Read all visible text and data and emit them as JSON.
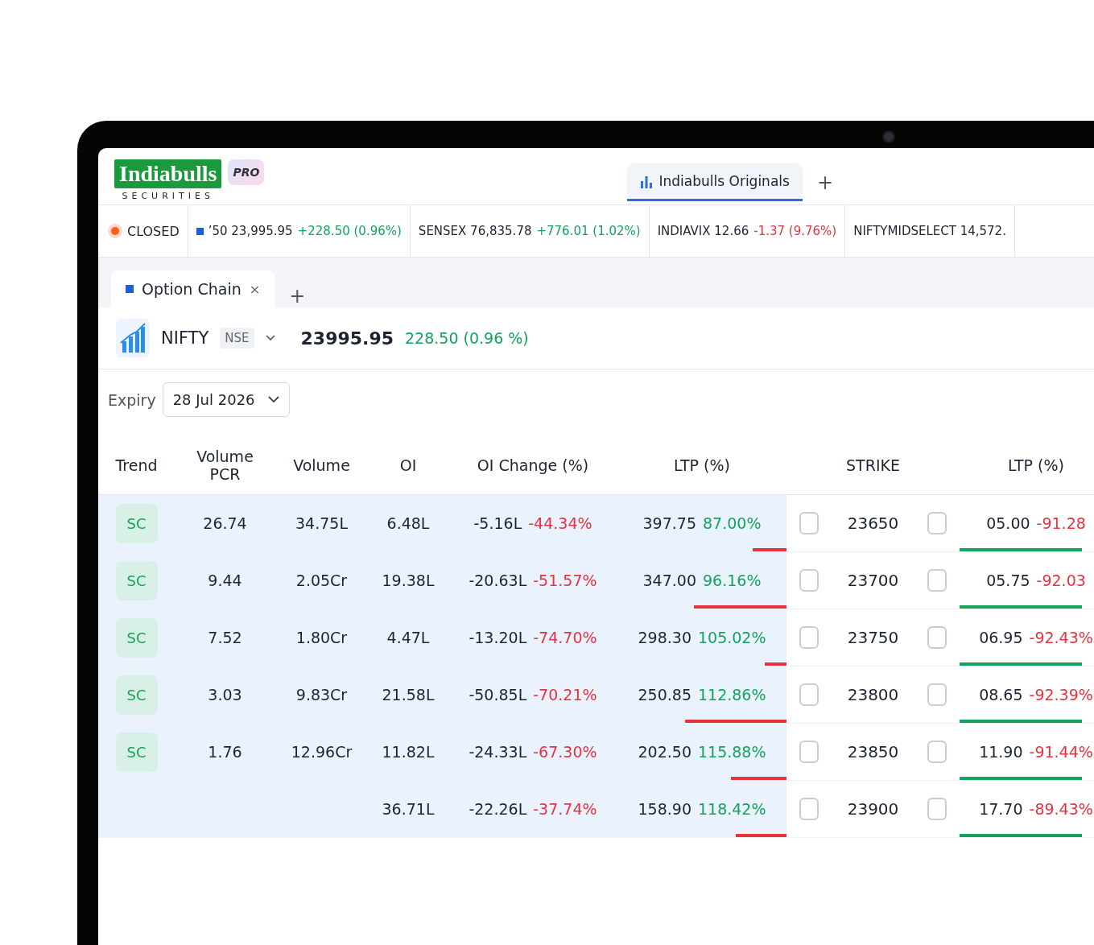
{
  "header": {
    "logo": {
      "name": "Indiabulls",
      "subtitle": "SECURITIES",
      "badge": "PRO"
    },
    "tabs": [
      {
        "label": "Indiabulls Originals",
        "selected": true
      }
    ],
    "add_tab": "+"
  },
  "ticker": {
    "market_status": "CLOSED",
    "items": [
      {
        "name": "’50",
        "value": "23,995.95",
        "change": "+228.50",
        "percent": "(0.96%)",
        "kind": "gain",
        "marker": true
      },
      {
        "name": "SENSEX",
        "value": "76,835.78",
        "change": "+776.01",
        "percent": "(1.02%)",
        "kind": "gain",
        "marker": false
      },
      {
        "name": "INDIAVIX",
        "value": "12.66",
        "change": "-1.37",
        "percent": "(9.76%)",
        "kind": "loss",
        "marker": false
      },
      {
        "name": "NIFTYMIDSELECT",
        "value": "14,572.",
        "kind": "plain",
        "marker": false
      }
    ]
  },
  "workspace_tabs": {
    "tabs": [
      {
        "label": "Option Chain",
        "selected": true,
        "close": "×"
      }
    ],
    "add_tab": "+"
  },
  "instrument": {
    "symbol": "NIFTY",
    "exchange": "NSE",
    "price": "23995.95",
    "change": "228.50 (0.96 %)"
  },
  "expiry": {
    "label": "Expiry",
    "value": "28 Jul 2026"
  },
  "table": {
    "columns": [
      "Trend",
      "Volume PCR",
      "Volume",
      "OI",
      "OI Change (%)",
      "LTP (%)",
      "STRIKE",
      "LTP (%)"
    ],
    "rows": [
      {
        "trend": "SC",
        "volume_pcr": "26.74",
        "volume": "34.75L",
        "oi": "6.48L",
        "oi_change": "-5.16L",
        "oi_change_pct": "-44.34%",
        "ltp": "397.75",
        "ltp_pct": "87.00%",
        "call_bar": {
          "level": 0.2
        },
        "call_checked": false,
        "strike": "23650",
        "put_checked": false,
        "put_ltp": "05.00",
        "put_ltp_pct": "-91.28",
        "put_bar": {
          "level": 0.8
        }
      },
      {
        "trend": "SC",
        "volume_pcr": "9.44",
        "volume": "2.05Cr",
        "oi": "19.38L",
        "oi_change": "-20.63L",
        "oi_change_pct": "-51.57%",
        "ltp": "347.00",
        "ltp_pct": "96.16%",
        "call_bar": {
          "level": 0.55
        },
        "call_checked": false,
        "strike": "23700",
        "put_checked": false,
        "put_ltp": "05.75",
        "put_ltp_pct": "-92.03",
        "put_bar": {
          "level": 0.8
        }
      },
      {
        "trend": "SC",
        "volume_pcr": "7.52",
        "volume": "1.80Cr",
        "oi": "4.47L",
        "oi_change": "-13.20L",
        "oi_change_pct": "-74.70%",
        "ltp": "298.30",
        "ltp_pct": "105.02%",
        "call_bar": {
          "level": 0.13
        },
        "call_checked": false,
        "strike": "23750",
        "put_checked": false,
        "put_ltp": "06.95",
        "put_ltp_pct": "-92.43%",
        "put_bar": {
          "level": 0.8
        }
      },
      {
        "trend": "SC",
        "volume_pcr": "3.03",
        "volume": "9.83Cr",
        "oi": "21.58L",
        "oi_change": "-50.85L",
        "oi_change_pct": "-70.21%",
        "ltp": "250.85",
        "ltp_pct": "112.86%",
        "call_bar": {
          "level": 0.6
        },
        "call_checked": false,
        "strike": "23800",
        "put_checked": false,
        "put_ltp": "08.65",
        "put_ltp_pct": "-92.39%",
        "put_bar": {
          "level": 0.8
        }
      },
      {
        "trend": "SC",
        "volume_pcr": "1.76",
        "volume": "12.96Cr",
        "oi": "11.82L",
        "oi_change": "-24.33L",
        "oi_change_pct": "-67.30%",
        "ltp": "202.50",
        "ltp_pct": "115.88%",
        "call_bar": {
          "level": 0.33
        },
        "call_checked": false,
        "strike": "23850",
        "put_checked": false,
        "put_ltp": "11.90",
        "put_ltp_pct": "-91.44%",
        "put_bar": {
          "level": 0.8
        }
      },
      {
        "oi": "36.71L",
        "oi_change": "-22.26L",
        "oi_change_pct": "-37.74%",
        "ltp": "158.90",
        "ltp_pct": "118.42%",
        "call_bar": {
          "level": 0.3
        },
        "call_checked": false,
        "strike": "23900",
        "put_checked": false,
        "put_ltp": "17.70",
        "put_ltp_pct": "-89.43%",
        "put_bar": {
          "level": 0.8
        }
      }
    ]
  }
}
